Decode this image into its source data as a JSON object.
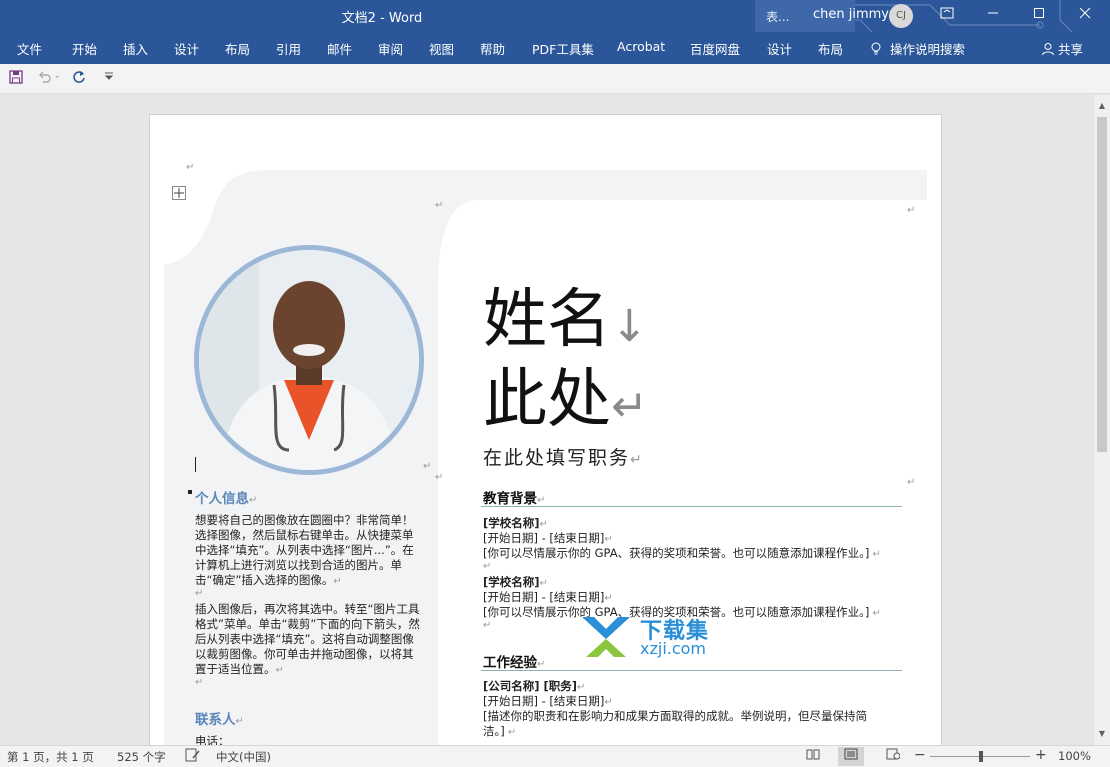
{
  "window": {
    "title": "文档2 - Word",
    "context_label": "表...",
    "user_name": "chen jimmy",
    "avatar_initials": "CJ"
  },
  "ribbon_tabs": [
    "文件",
    "开始",
    "插入",
    "设计",
    "布局",
    "引用",
    "邮件",
    "审阅",
    "视图",
    "帮助",
    "PDF工具集",
    "Acrobat",
    "百度网盘",
    "设计",
    "布局"
  ],
  "tell_me": "操作说明搜索",
  "share": "共享",
  "resume": {
    "name_line1": "姓名",
    "name_line2": "此处",
    "job_title": "在此处填写职务",
    "personal_info_heading": "个人信息",
    "personal_info_para1": "想要将自己的图像放在圆圈中？非常简单！选择图像，然后鼠标右键单击。从快捷菜单中选择“填充”。从列表中选择“图片...”。在计算机上进行浏览以找到合适的图片。单击“确定”插入选择的图像。",
    "personal_info_para2": "插入图像后，再次将其选中。转至“图片工具格式”菜单。单击“裁剪”下面的向下箭头，然后从列表中选择“填充”。这将自动调整图像以裁剪图像。你可单击并拖动图像，以将其置于适当位置。",
    "contact_heading": "联系人",
    "phone_label": "电话：",
    "education_heading": "教育背景",
    "education": [
      {
        "school": "[学校名称]",
        "dates": "[开始日期] - [结束日期]",
        "desc": "[你可以尽情展示你的 GPA、获得的奖项和荣誉。也可以随意添加课程作业。]"
      },
      {
        "school": "[学校名称]",
        "dates": "[开始日期] - [结束日期]",
        "desc": "[你可以尽情展示你的 GPA、获得的奖项和荣誉。也可以随意添加课程作业。]"
      }
    ],
    "work_heading": "工作经验",
    "work": {
      "company": "[公司名称]  [职务]",
      "dates": "[开始日期] - [结束日期]",
      "desc_line1": "[描述你的职责和在影响力和成果方面取得的成就。举例说明，但尽量保持简",
      "desc_line2": "洁。]"
    }
  },
  "watermark": {
    "text": "下载集",
    "site": "xzji.com"
  },
  "status": {
    "page": "第 1 页，共 1 页",
    "words": "525 个字",
    "language": "中文(中国)",
    "zoom": "100%",
    "zoom_level": 1.0
  },
  "colors": {
    "ribbon": "#2b579a",
    "accent_blue": "#5b86b8",
    "photo_ring": "#9db7d6",
    "section_rule": "#8fb4b8",
    "panel_gray": "#f2f3f5"
  }
}
